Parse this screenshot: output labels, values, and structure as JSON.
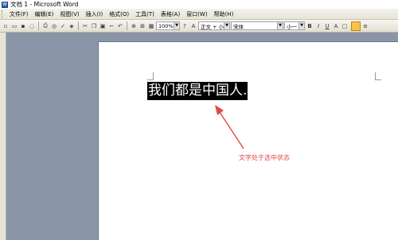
{
  "window": {
    "title": "文档 1 - Microsoft Word"
  },
  "menubar": {
    "items": [
      {
        "label": "文件(F)"
      },
      {
        "label": "编辑(E)"
      },
      {
        "label": "视图(V)"
      },
      {
        "label": "插入(I)"
      },
      {
        "label": "格式(O)"
      },
      {
        "label": "工具(T)"
      },
      {
        "label": "表格(A)"
      },
      {
        "label": "窗口(W)"
      },
      {
        "label": "帮助(H)"
      }
    ]
  },
  "toolbar": {
    "zoom": "100%",
    "style": "正文 + 小一",
    "font": "宋体",
    "size": "小一",
    "bold": "B",
    "italic": "I",
    "underline": "U",
    "font_color": "A"
  },
  "document": {
    "selected_text": "我们都是中国人.",
    "annotation": "文字处于选中状态",
    "annotation_color": "#e64646"
  }
}
